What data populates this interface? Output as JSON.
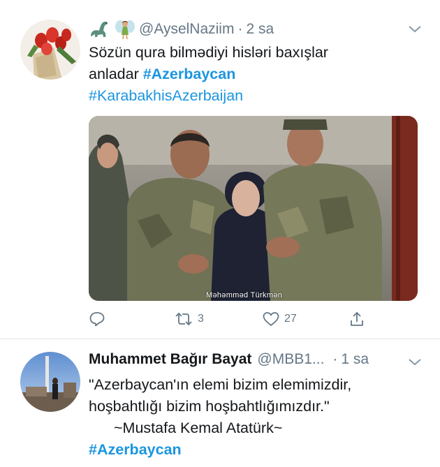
{
  "tweets": [
    {
      "handle": "@AyselNaziim",
      "dot": "·",
      "time": "2 sa",
      "emojis": [
        "sauropod-emoji",
        "fairy-emoji"
      ],
      "text_line1": "Sözün qura bilmədiyi hisləri baxışlar",
      "text_line2_prefix": "anladar ",
      "hashtag1": "#Azerbaycan",
      "hashtag2": "#KarabakhisAzerbaijan",
      "media_credit": "Məhəmməd Türkmən",
      "retweets": "3",
      "likes": "27"
    },
    {
      "name": "Muhammet Bağır Bayat",
      "handle": "@MBB1...",
      "dot": "·",
      "time": "1 sa",
      "line1": "\"Azerbaycan'ın elemi bizim elemimizdir,",
      "line2": "hoşbahtlığı bizim hoşbahtlığımızdır.\"",
      "line3": "~Mustafa Kemal Atatürk~",
      "hashtag": "#Azerbaycan"
    }
  ],
  "colors": {
    "link": "#1b95e0",
    "secondary": "#657786",
    "text": "#14171a",
    "divider": "#e1e8ed"
  }
}
